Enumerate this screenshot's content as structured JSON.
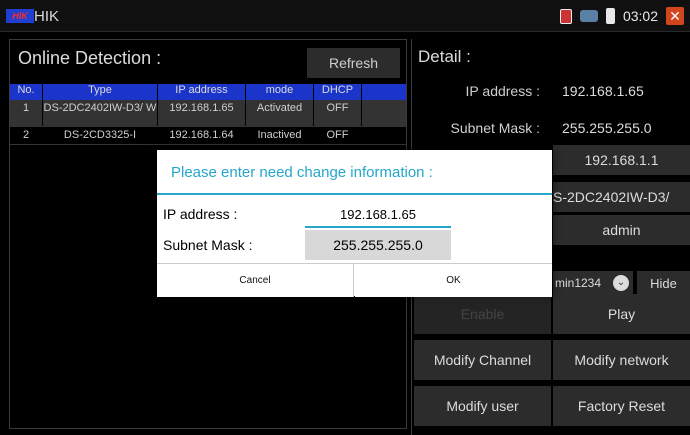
{
  "app": {
    "logo_text": "HIK",
    "title": "HIK"
  },
  "status": {
    "time": "03:02"
  },
  "online": {
    "title": "Online Detection :",
    "refresh_label": "Refresh",
    "columns": [
      "No.",
      "Type",
      "IP address",
      "mode",
      "DHCP"
    ],
    "rows": [
      {
        "no": "1",
        "type": "DS-2DC2402IW-D3/ W",
        "ip": "192.168.1.65",
        "mode": "Activated",
        "dhcp": "OFF"
      },
      {
        "no": "2",
        "type": "DS-2CD3325-I",
        "ip": "192.168.1.64",
        "mode": "Inactived",
        "dhcp": "OFF"
      }
    ]
  },
  "detail": {
    "title": "Detail :",
    "ip_label": "IP address :",
    "ip_value": "192.168.1.65",
    "mask_label": "Subnet Mask :",
    "mask_value": "255.255.255.0",
    "gateway_value": "192.168.1.1",
    "device_type_value": "S-2DC2402IW-D3/",
    "username_value": "admin",
    "password_value": "min1234",
    "hide_label": "Hide",
    "buttons": {
      "enable": "Enable",
      "play": "Play",
      "modify_channel": "Modify Channel",
      "modify_network": "Modify network",
      "modify_user": "Modify user",
      "factory_reset": "Factory Reset"
    }
  },
  "dialog": {
    "title": "Please enter need change information :",
    "ip_label": "IP address :",
    "ip_value": "192.168.1.65",
    "mask_label": "Subnet Mask :",
    "mask_value": "255.255.255.0",
    "cancel_label": "Cancel",
    "ok_label": "OK"
  }
}
